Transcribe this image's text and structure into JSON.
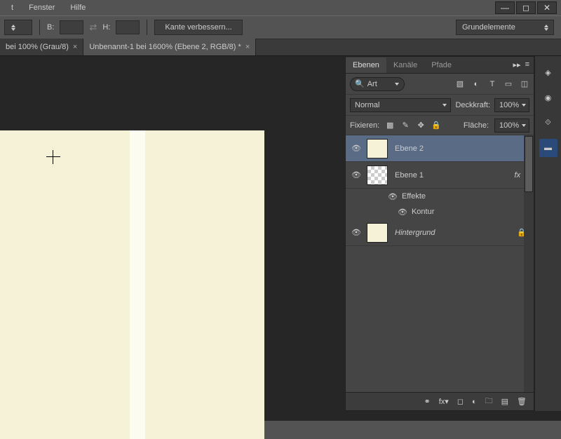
{
  "menu": {
    "items": [
      "t",
      "Fenster",
      "Hilfe"
    ]
  },
  "optbar": {
    "b_label": "B:",
    "h_label": "H:",
    "refine_edge": "Kante verbessern...",
    "workspace": "Grundelemente"
  },
  "tabs": [
    {
      "title": "bei 100% (Grau/8)",
      "active": false
    },
    {
      "title": "Unbenannt-1 bei 1600% (Ebene 2, RGB/8) *",
      "active": true
    }
  ],
  "layers_panel": {
    "tabs": [
      "Ebenen",
      "Kanäle",
      "Pfade"
    ],
    "search_label": "Art",
    "blend_mode": "Normal",
    "opacity_label": "Deckkraft:",
    "opacity_value": "100%",
    "fill_label": "Fläche:",
    "fill_value": "100%",
    "lock_label": "Fixieren:",
    "layers": [
      {
        "name": "Ebene 2",
        "selected": true,
        "thumb": "solid"
      },
      {
        "name": "Ebene 1",
        "selected": false,
        "thumb": "checker",
        "fx": true,
        "effects_label": "Effekte",
        "effect_items": [
          "Kontur"
        ]
      },
      {
        "name": "Hintergrund",
        "selected": false,
        "thumb": "solid",
        "locked": true,
        "italic": true
      }
    ]
  }
}
